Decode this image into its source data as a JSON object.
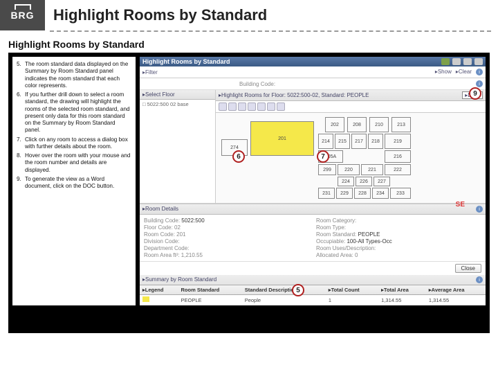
{
  "logo": "BRG",
  "title": "Highlight Rooms by Standard",
  "subtitle": "Highlight Rooms by Standard",
  "instructions": [
    {
      "n": "5.",
      "t": "The room standard data displayed on the Summary by Room Standard panel indicates the room standard that each color represents."
    },
    {
      "n": "6.",
      "t": "If you further drill down to select a room standard, the drawing will highlight the rooms of the selected room standard, and present only data for this room standard on the Summary by Room Standard panel."
    },
    {
      "n": "7.",
      "t": "Click on any room to access a dialog box with further details about the room."
    },
    {
      "n": "8.",
      "t": "Hover over the room with your mouse and the room number and details are displayed."
    },
    {
      "n": "9.",
      "t": "To generate the view as a Word document, click on the DOC button."
    }
  ],
  "section": {
    "title": "Highlight Rooms by Standard"
  },
  "filter": {
    "label": "▸Filter",
    "show": "▸Show",
    "clear": "▸Clear"
  },
  "bldg": {
    "lbl": "Building Code:",
    "val": ""
  },
  "selectFloor": {
    "hdr": "▸Select Floor",
    "item": "□ 5022:500 02 base"
  },
  "highlight": {
    "hdr": "▸Highlight Rooms for Floor: 5022:500-02, Standard: PEOPLE",
    "doc": "▸DOC"
  },
  "rooms": {
    "r201": "201",
    "r202": "202",
    "r208": "208",
    "r210": "210",
    "r213": "213",
    "r214": "214",
    "r215": "215",
    "r217": "217",
    "r218": "218",
    "r219": "219",
    "r274": "274",
    "r205a": "205A",
    "r219b": "219",
    "r220": "220",
    "r221": "221",
    "r222": "222",
    "r224": "224",
    "r226": "226",
    "r227": "227",
    "r231": "231",
    "r229": "229",
    "r228": "228",
    "r234": "234",
    "r233": "233",
    "r216": "216",
    "r299": "299"
  },
  "details": {
    "hdr": "▸Room Details",
    "bldgL": "Building Code:",
    "bldgV": "5022:500",
    "catL": "Room Category:",
    "catV": "",
    "flL": "Floor Code: 02",
    "flV": "",
    "typeL": "Room Type:",
    "typeV": "",
    "rmL": "Room Code: 201",
    "stdL": "Room Standard:",
    "stdV": "PEOPLE",
    "divL": "Division Code:",
    "occL": "Occupiable:",
    "occV": "100-All Types-Occ",
    "deptL": "Department Code:",
    "usesL": "Room Uses/Description:",
    "areaL": "Room Area ft²: 1,210.55",
    "allocL": "Allocated Area: 0"
  },
  "close": "Close",
  "summary": {
    "hdr": "▸Summary by Room Standard",
    "legend": "▸Legend",
    "c1": "Room Standard",
    "c2": "Standard Description",
    "c3": "▸Total Count",
    "c4": "▸Total Area",
    "c5": "▸Average Area",
    "r1": "PEOPLE",
    "r2": "People",
    "r3": "1",
    "r4": "1,314.55",
    "r5": "1,314.55"
  },
  "callouts": {
    "c5": "5",
    "c6": "6",
    "c7": "7",
    "c9": "9"
  },
  "se": "SE"
}
